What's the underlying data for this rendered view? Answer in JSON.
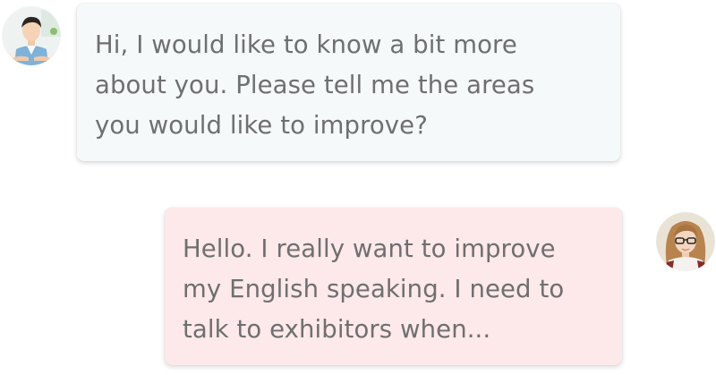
{
  "chat": {
    "messages": [
      {
        "sender": "agent",
        "avatar_icon": "boy-avatar-icon",
        "bubble_color": "#f5f9fa",
        "lines": [
          "Hi, I would like to know a bit more",
          "about you. Please tell me the areas",
          "you would like to improve?"
        ]
      },
      {
        "sender": "user",
        "avatar_icon": "woman-glasses-avatar-icon",
        "bubble_color": "#fde9ea",
        "lines": [
          "Hello. I really want to improve",
          "my English speaking. I need to",
          "talk to exhibitors when..."
        ]
      }
    ]
  }
}
